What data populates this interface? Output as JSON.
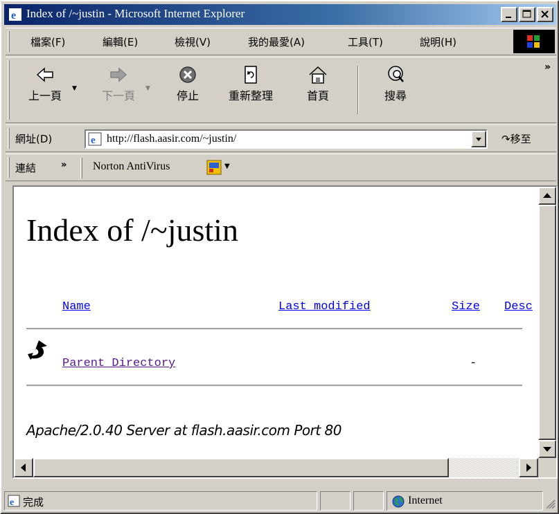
{
  "window": {
    "title": "Index of /~justin - Microsoft Internet Explorer"
  },
  "menu": {
    "items": [
      "檔案(F)",
      "編輯(E)",
      "檢視(V)",
      "我的最愛(A)",
      "工具(T)",
      "說明(H)"
    ]
  },
  "toolbar": {
    "back_label": "上一頁",
    "forward_label": "下一頁",
    "stop_label": "停止",
    "refresh_label": "重新整理",
    "home_label": "首頁",
    "search_label": "搜尋",
    "more": "»"
  },
  "address": {
    "label": "網址(D)",
    "url": "http://flash.aasir.com/~justin/",
    "go_label": "移至"
  },
  "links": {
    "label": "連結",
    "chevron": "»",
    "item": "Norton AntiVirus"
  },
  "page": {
    "heading": "Index of /~justin",
    "columns": {
      "name": "Name",
      "last_modified": "Last modified",
      "size": "Size",
      "description": "Desc"
    },
    "rows": [
      {
        "name": "Parent Directory",
        "size": "-"
      }
    ],
    "footer": "Apache/2.0.40 Server at flash.aasir.com Port 80"
  },
  "status": {
    "text": "完成",
    "zone": "Internet"
  },
  "colors": {
    "titlebar": "#0a246a",
    "link": "#0000ee",
    "visited": "#551a8b",
    "chrome": "#d4d0c8"
  }
}
